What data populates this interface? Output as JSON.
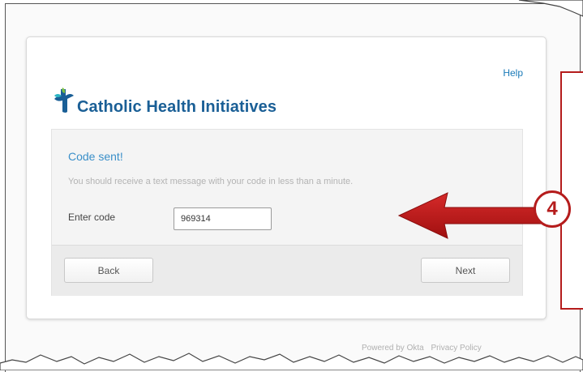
{
  "header": {
    "help_label": "Help",
    "brand_name": "Catholic Health Initiatives"
  },
  "form": {
    "title": "Code sent!",
    "description": "You should receive a text message with your code in less than a minute.",
    "code_label": "Enter code",
    "code_value": "969314",
    "back_label": "Back",
    "next_label": "Next"
  },
  "footer": {
    "powered_by": "Powered by Okta",
    "privacy_label": "Privacy Policy"
  },
  "annotation": {
    "step_number": "4",
    "color": "#b51c1c"
  },
  "colors": {
    "brand": "#1a5f96",
    "link": "#1a7ab8",
    "accent_teal": "#2cb5c4"
  },
  "icons": [
    "logo-cross-icon",
    "annotation-arrow-icon"
  ]
}
